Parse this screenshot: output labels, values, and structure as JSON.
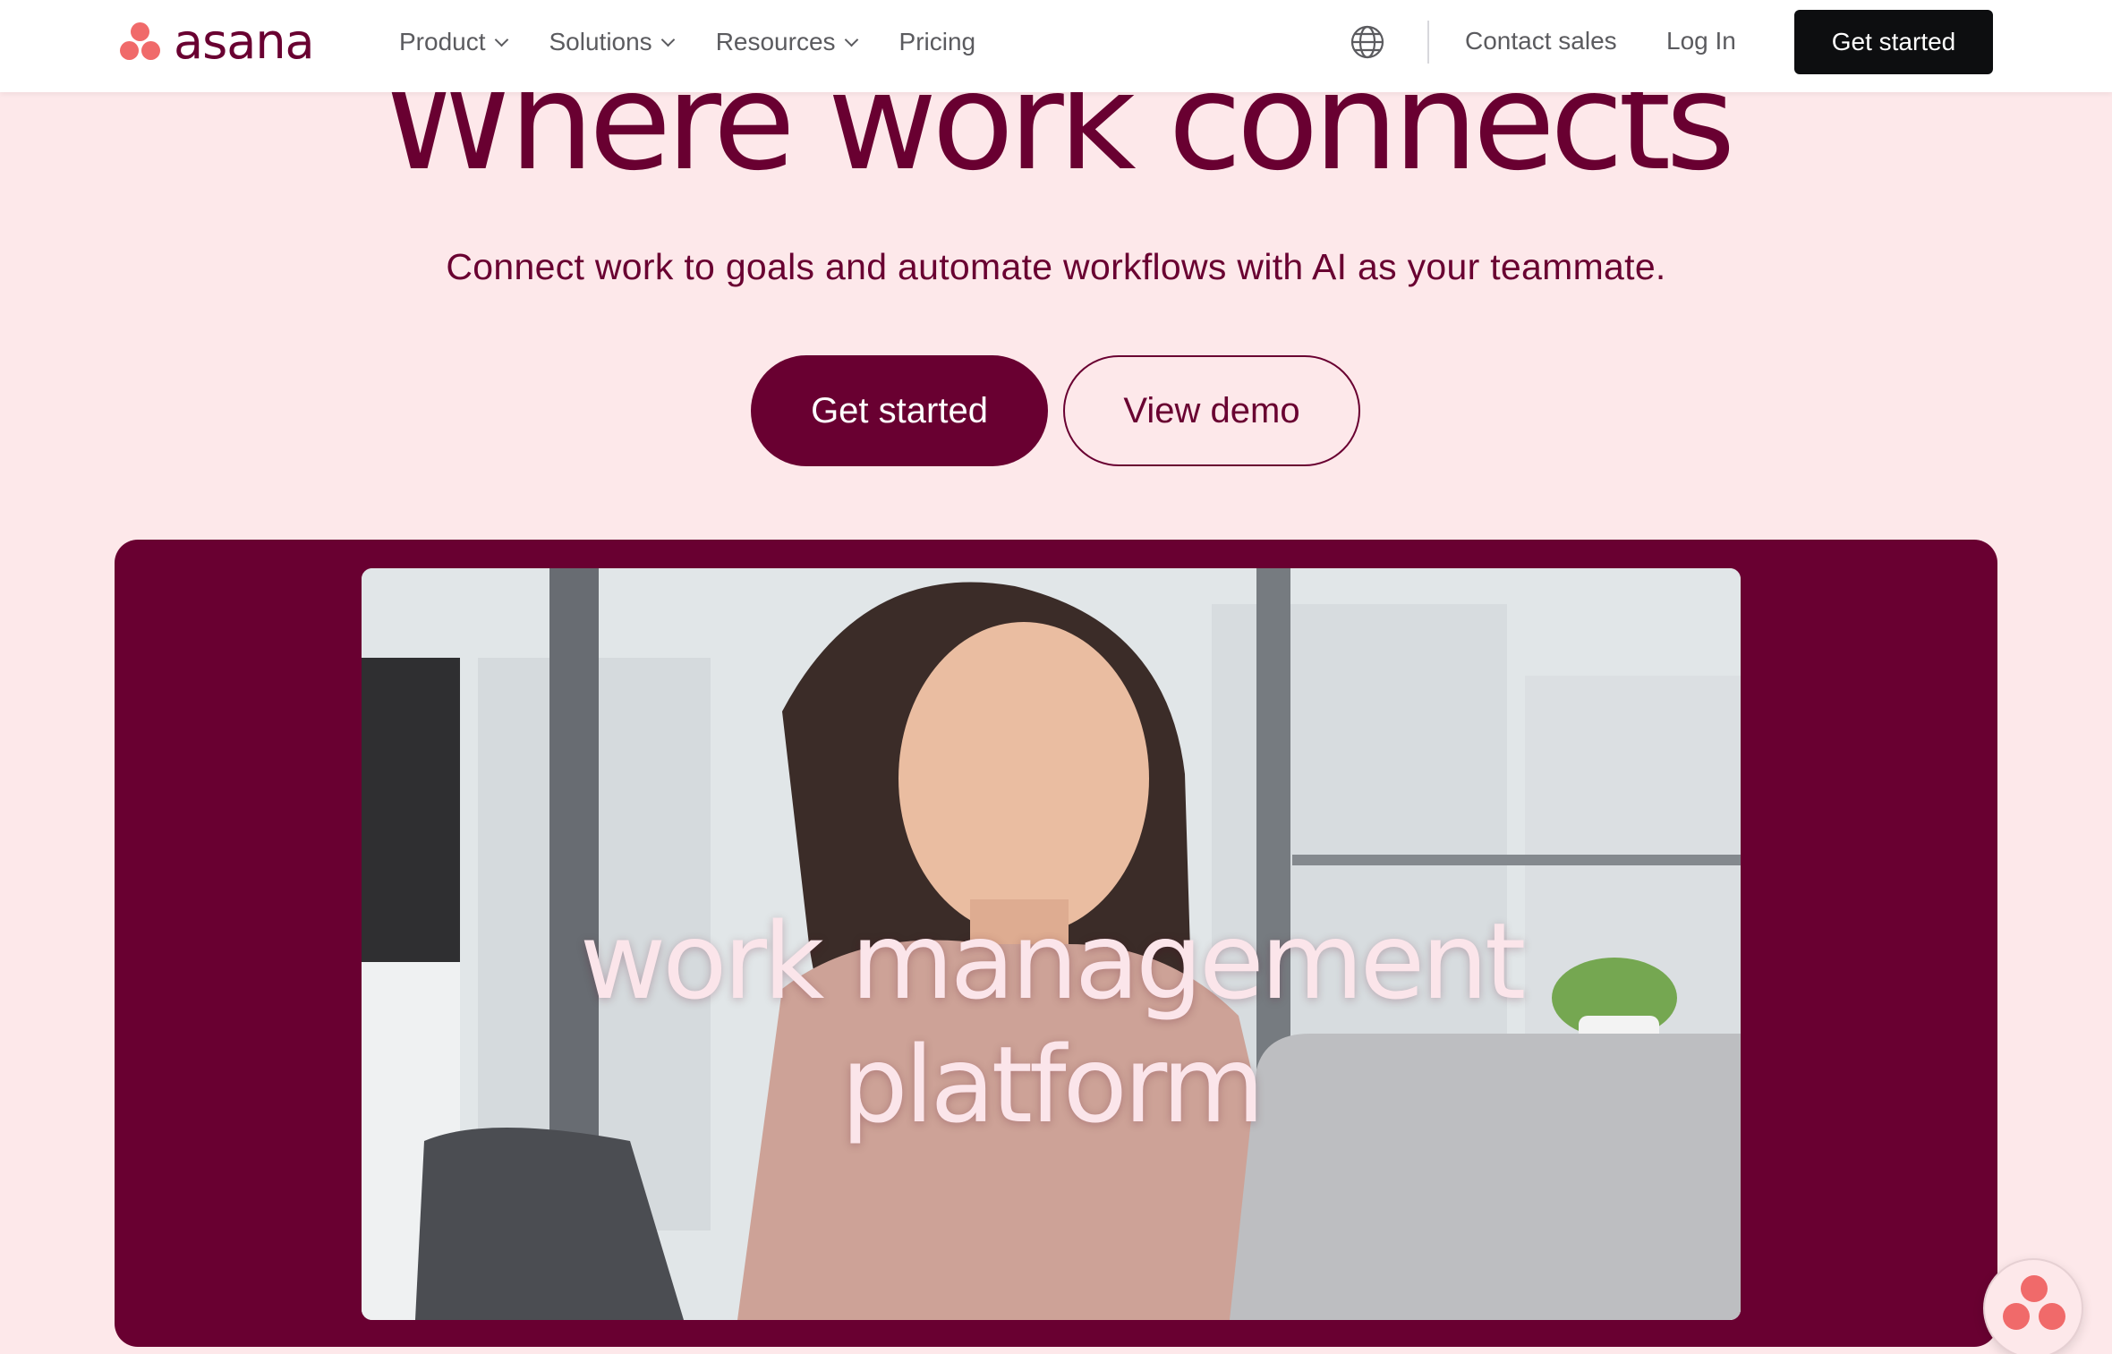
{
  "nav": {
    "logo_text": "asana",
    "links": [
      {
        "label": "Product",
        "dropdown": true
      },
      {
        "label": "Solutions",
        "dropdown": true
      },
      {
        "label": "Resources",
        "dropdown": true
      },
      {
        "label": "Pricing",
        "dropdown": false
      }
    ],
    "globe_icon": "globe-icon",
    "contact_label": "Contact sales",
    "login_label": "Log In",
    "cta_label": "Get started"
  },
  "hero": {
    "title": "Where work connects",
    "subtitle": "Connect work to goals and automate workflows with AI as your teammate.",
    "primary_button": "Get started",
    "secondary_button": "View demo"
  },
  "video": {
    "caption": "work management platform"
  },
  "colors": {
    "brand": "#690031",
    "background": "#fde8ea",
    "logo_coral": "#f06a6a",
    "nav_cta": "#0d0e10"
  }
}
